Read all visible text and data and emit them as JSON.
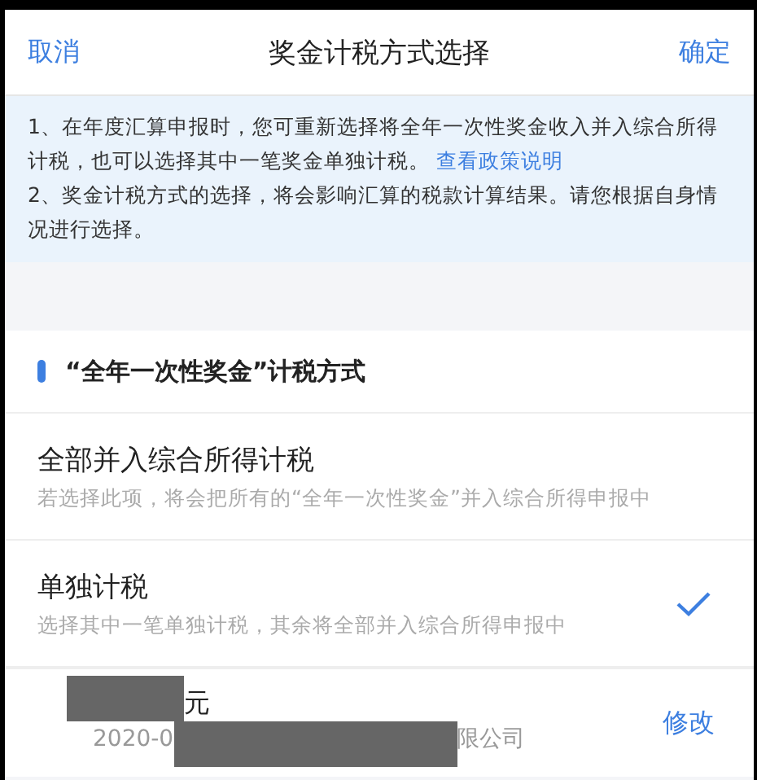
{
  "header": {
    "cancel": "取消",
    "title": "奖金计税方式选择",
    "confirm": "确定"
  },
  "notice": {
    "lines": [
      {
        "text": "1、在年度汇算申报时，您可重新选择将全年一次性奖金收入并入综合所得计税，也可以选择其中一笔奖金单独计税。",
        "link": "查看政策说明"
      },
      {
        "text": "2、奖金计税方式的选择，将会影响汇算的税款计算结果。请您根据自身情况进行选择。"
      }
    ]
  },
  "section": {
    "title": "“全年一次性奖金”计税方式"
  },
  "options": [
    {
      "label": "全部并入综合所得计税",
      "description": "若选择此项，将会把所有的“全年一次性奖金”并入综合所得申报中",
      "selected": false
    },
    {
      "label": "单独计税",
      "description": "选择其中一笔单独计税，其余将全部并入综合所得申报中",
      "selected": true
    }
  ],
  "bonus": {
    "amount": [
      {
        "kind": "redacted"
      },
      {
        "kind": "text",
        "text": "元"
      }
    ],
    "detail": [
      {
        "kind": "text",
        "text": "2020-0"
      },
      {
        "kind": "redacted"
      },
      {
        "kind": "text",
        "text": "限公司"
      }
    ],
    "action": "修改"
  }
}
